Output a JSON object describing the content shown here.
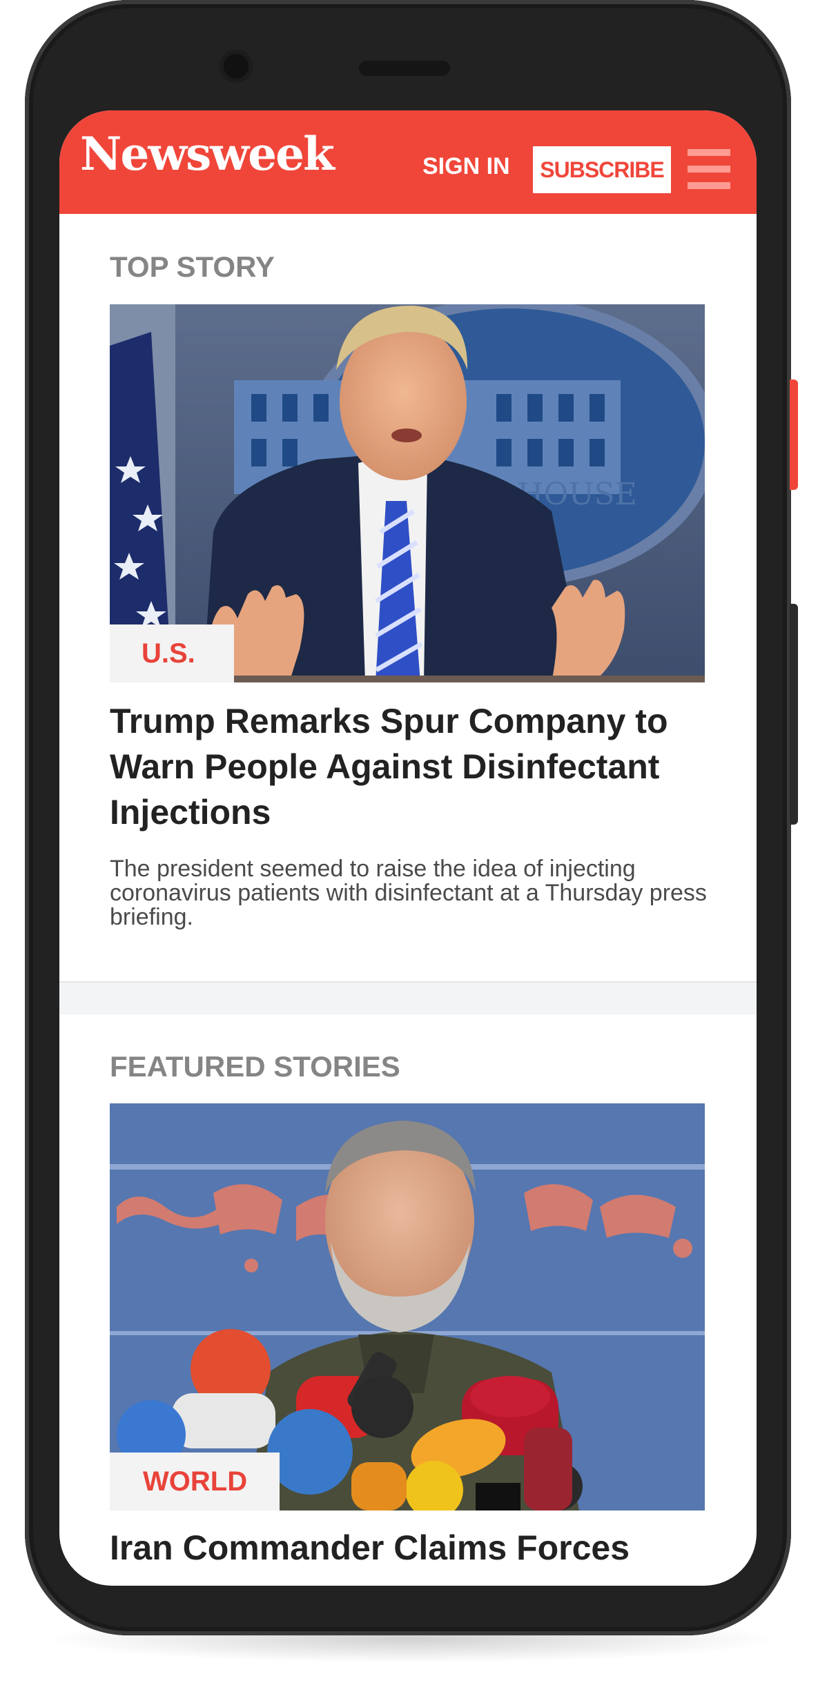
{
  "header": {
    "logo": "Newsweek",
    "sign_in_label": "SIGN IN",
    "subscribe_label": "SUBSCRIBE",
    "menu_icon": "hamburger-menu-icon",
    "brand_color": "#f0463a"
  },
  "top_story": {
    "section_label": "TOP STORY",
    "category": "U.S.",
    "headline": "Trump Remarks Spur Company to Warn People Against Disinfectant Injections",
    "dek": "The president seemed to raise the idea of injecting coronavirus patients with disinfectant at a Thursday press briefing.",
    "image_backdrop_text": "HOUSE"
  },
  "featured": {
    "section_label": "FEATURED STORIES",
    "category": "WORLD",
    "headline": "Iran Commander Claims Forces"
  }
}
